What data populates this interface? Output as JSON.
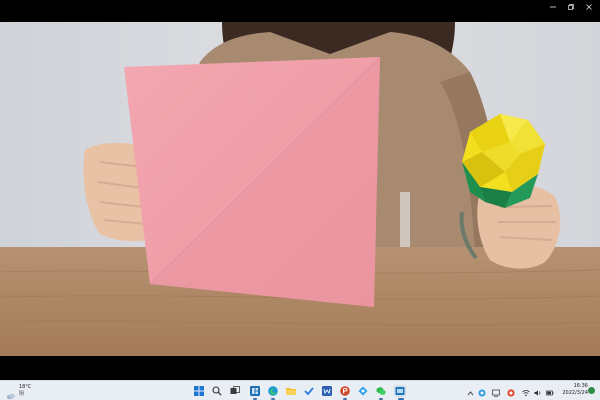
{
  "window": {
    "controls": {
      "minimize_icon": "minimize-icon",
      "maximize_icon": "restore-icon",
      "close_icon": "close-icon"
    }
  },
  "video": {
    "scene": "origami-demo",
    "colors": {
      "wall": "#d7d8dd",
      "table": "#b08a63",
      "paper": "#f0a1ab",
      "sweater": "#a98b72",
      "origami_yellow": "#f2df1e",
      "origami_green": "#1e8f4d"
    }
  },
  "taskbar": {
    "weather": {
      "temp": "18°C",
      "condition": "阴"
    },
    "pinned": [
      {
        "name": "start-icon"
      },
      {
        "name": "search-icon"
      },
      {
        "name": "task-view-icon"
      },
      {
        "name": "widgets-icon"
      },
      {
        "name": "edge-icon"
      },
      {
        "name": "file-explorer-icon"
      },
      {
        "name": "todo-icon"
      },
      {
        "name": "word-icon"
      },
      {
        "name": "powerpoint-icon"
      },
      {
        "name": "app-icon"
      },
      {
        "name": "wechat-icon"
      },
      {
        "name": "active-app-icon"
      }
    ],
    "tray": {
      "icons": [
        "chevron-up-icon",
        "app-tray-icon",
        "network-icon",
        "app-tray-icon-2",
        "wifi-icon",
        "volume-icon",
        "battery-icon"
      ],
      "time": "16:36",
      "date": "2022/3/24"
    },
    "colors": {
      "accent": "#2f6fb5"
    }
  }
}
